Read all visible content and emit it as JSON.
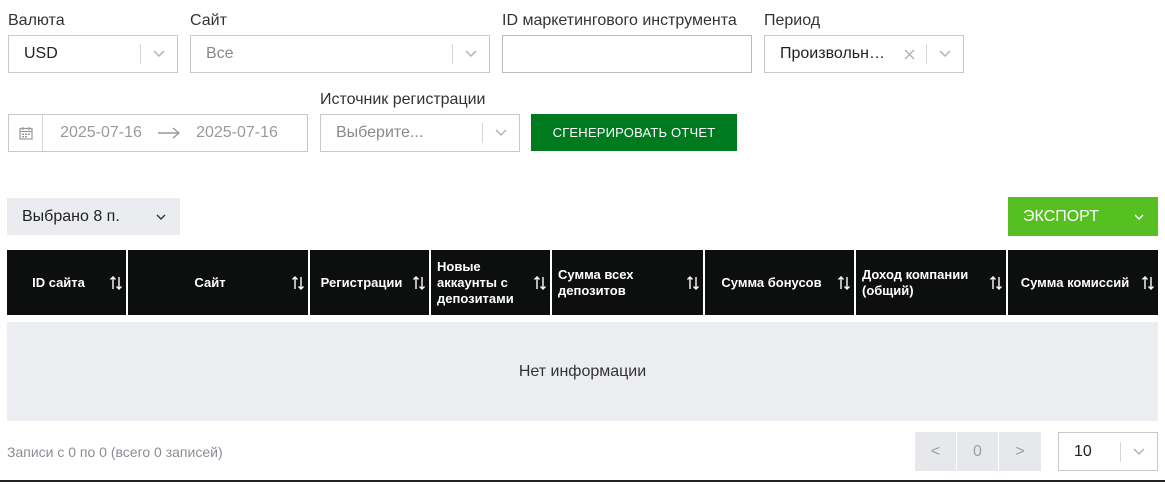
{
  "filters": {
    "currency": {
      "label": "Валюта",
      "value": "USD"
    },
    "site": {
      "label": "Сайт",
      "value": "Все"
    },
    "marketing_tool_id": {
      "label": "ID маркетингового инструмента",
      "value": ""
    },
    "period": {
      "label": "Период",
      "value": "Произвольн…"
    },
    "date_from": "2025-07-16",
    "date_to": "2025-07-16",
    "registration_source": {
      "label": "Источник регистрации",
      "placeholder": "Выберите..."
    },
    "generate_label": "Сгенерировать отчет"
  },
  "toolbar": {
    "columns_selected": "Выбрано 8 п.",
    "export_label": "ЭКСПОРТ"
  },
  "table": {
    "columns": [
      {
        "label": "ID сайта"
      },
      {
        "label": "Сайт"
      },
      {
        "label": "Регистрации"
      },
      {
        "label": "Новые аккаунты с депозитами"
      },
      {
        "label": "Сумма всех депозитов"
      },
      {
        "label": "Сумма бонусов"
      },
      {
        "label": "Доход компании (общий)"
      },
      {
        "label": "Сумма комиссий"
      }
    ],
    "empty_text": "Нет информации"
  },
  "footer": {
    "records_info": "Записи с 0 по 0 (всего 0 записей)",
    "prev": "<",
    "page": "0",
    "next": ">",
    "page_size": "10"
  },
  "colors": {
    "generate_button": "#007a1f",
    "export_button": "#56bf21",
    "table_header": "#0d0f0e",
    "empty_row": "#ebedf0"
  },
  "icons": {
    "chevron": "chevron-down-icon",
    "calendar": "calendar-icon",
    "arrow": "arrow-right-icon",
    "clear": "close-icon",
    "sort": "sort-icon"
  }
}
